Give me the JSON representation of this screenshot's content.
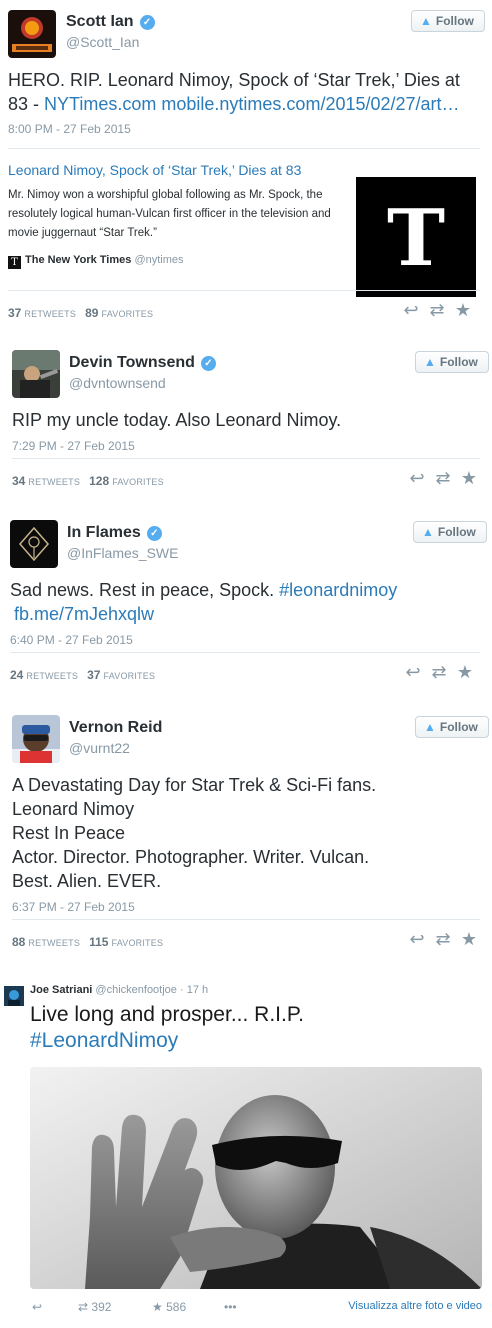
{
  "colors": {
    "link": "#2b7bb9",
    "verified": "#55acee",
    "muted": "#8899a6",
    "text": "#292f33"
  },
  "tweets": [
    {
      "name": "Scott Ian",
      "handle": "@Scott_Ian",
      "follow_label": "Follow",
      "text_plain": "HERO. RIP. Leonard Nimoy, Spock of ‘Star Trek,’ Dies at 83 - ",
      "text_link1": "NYTimes.com",
      "text_link2": "mobile.nytimes.com/2015/02/27/art…",
      "timestamp": "8:00 PM - 27 Feb 2015",
      "card": {
        "title": "Leonard Nimoy, Spock of ‘Star Trek,’ Dies at 83",
        "description": "Mr. Nimoy won a worshipful global following as Mr. Spock, the resolutely logical human-Vulcan first officer in the television and movie juggernaut “Star Trek.”",
        "source_name": "The New York Times",
        "source_handle": "@nytimes",
        "logo_letter": "T"
      },
      "retweets": "37",
      "retweets_label": "Retweets",
      "favorites": "89",
      "favorites_label": "Favorites"
    },
    {
      "name": "Devin Townsend",
      "handle": "@dvntownsend",
      "follow_label": "Follow",
      "text_plain": "RIP my uncle today. Also Leonard Nimoy.",
      "timestamp": "7:29 PM - 27 Feb 2015",
      "retweets": "34",
      "retweets_label": "Retweets",
      "favorites": "128",
      "favorites_label": "Favorites"
    },
    {
      "name": "In Flames",
      "handle": "@InFlames_SWE",
      "follow_label": "Follow",
      "text_plain": "Sad news. Rest in peace, Spock. ",
      "text_hashtag": "#leonardnimoy",
      "text_link1": "fb.me/7mJehxqlw",
      "timestamp": "6:40 PM - 27 Feb 2015",
      "retweets": "24",
      "retweets_label": "Retweets",
      "favorites": "37",
      "favorites_label": "Favorites"
    },
    {
      "name": "Vernon Reid",
      "handle": "@vurnt22",
      "follow_label": "Follow",
      "text_lines": [
        "A Devastating Day for Star Trek & Sci-Fi fans.",
        "Leonard Nimoy",
        "Rest In Peace",
        "Actor. Director. Photographer. Writer. Vulcan.",
        "Best. Alien. EVER."
      ],
      "timestamp": "6:37 PM - 27 Feb 2015",
      "retweets": "88",
      "retweets_label": "Retweets",
      "favorites": "115",
      "favorites_label": "Favorites"
    }
  ],
  "last_tweet": {
    "name": "Joe Satriani",
    "handle": "@chickenfootjoe",
    "time": "· 17 h",
    "text": "Live long and prosper... R.I.P.",
    "hashtag": "#LeonardNimoy",
    "retweets": "392",
    "favorites": "586",
    "more_label": "Visualizza altre foto e video"
  },
  "icons": {
    "reply": "↩",
    "retweet": "⇄",
    "favorite": "★",
    "more": "•••",
    "bird": "🐦",
    "check": "✓"
  }
}
